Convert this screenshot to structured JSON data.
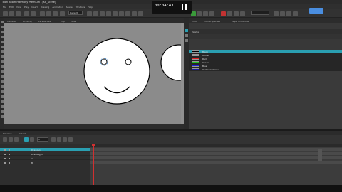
{
  "window": {
    "title": "Toon Boom Harmony Premium - [sd_scene]"
  },
  "menu": [
    "File",
    "Edit",
    "View",
    "Play",
    "Insert",
    "Drawing",
    "Animation",
    "Scene",
    "Windows",
    "Help"
  ],
  "recorder": {
    "time": "00:04:43"
  },
  "toolbar": {
    "combo_value": "Default",
    "field_value": "",
    "blue_button": ""
  },
  "viewport": {
    "tabs": [
      "Camera",
      "Drawing",
      "Perspective",
      "Top",
      "Side"
    ],
    "status_center": "",
    "status_right": ""
  },
  "right_panel": {
    "tabs": [
      "Color",
      "Tool Properties",
      "Layer Properties"
    ],
    "header": "Palette",
    "sub": "",
    "colors": [
      {
        "name": "Black",
        "hex": "#000000",
        "selected": true
      },
      {
        "name": "White",
        "hex": "#ffffff",
        "selected": false
      },
      {
        "name": "Red",
        "hex": "#e02020",
        "selected": false
      },
      {
        "name": "Green",
        "hex": "#20c020",
        "selected": false
      },
      {
        "name": "Blue",
        "hex": "#2020e0",
        "selected": false
      },
      {
        "name": "Vectorized Line",
        "hex": "#1a1aa0",
        "selected": false
      }
    ]
  },
  "timeline": {
    "tabs": [
      "Timeline",
      "Xsheet"
    ],
    "frame": "1",
    "layers": [
      {
        "name": "Drawing",
        "selected": true
      },
      {
        "name": "Drawing_1",
        "selected": false
      },
      {
        "name": "A",
        "selected": false
      },
      {
        "name": "B",
        "selected": false
      }
    ]
  },
  "colors": {
    "accent": "#2a9fb1",
    "playhead": "#d03030",
    "canvas_bg": "#8b8b8b"
  }
}
